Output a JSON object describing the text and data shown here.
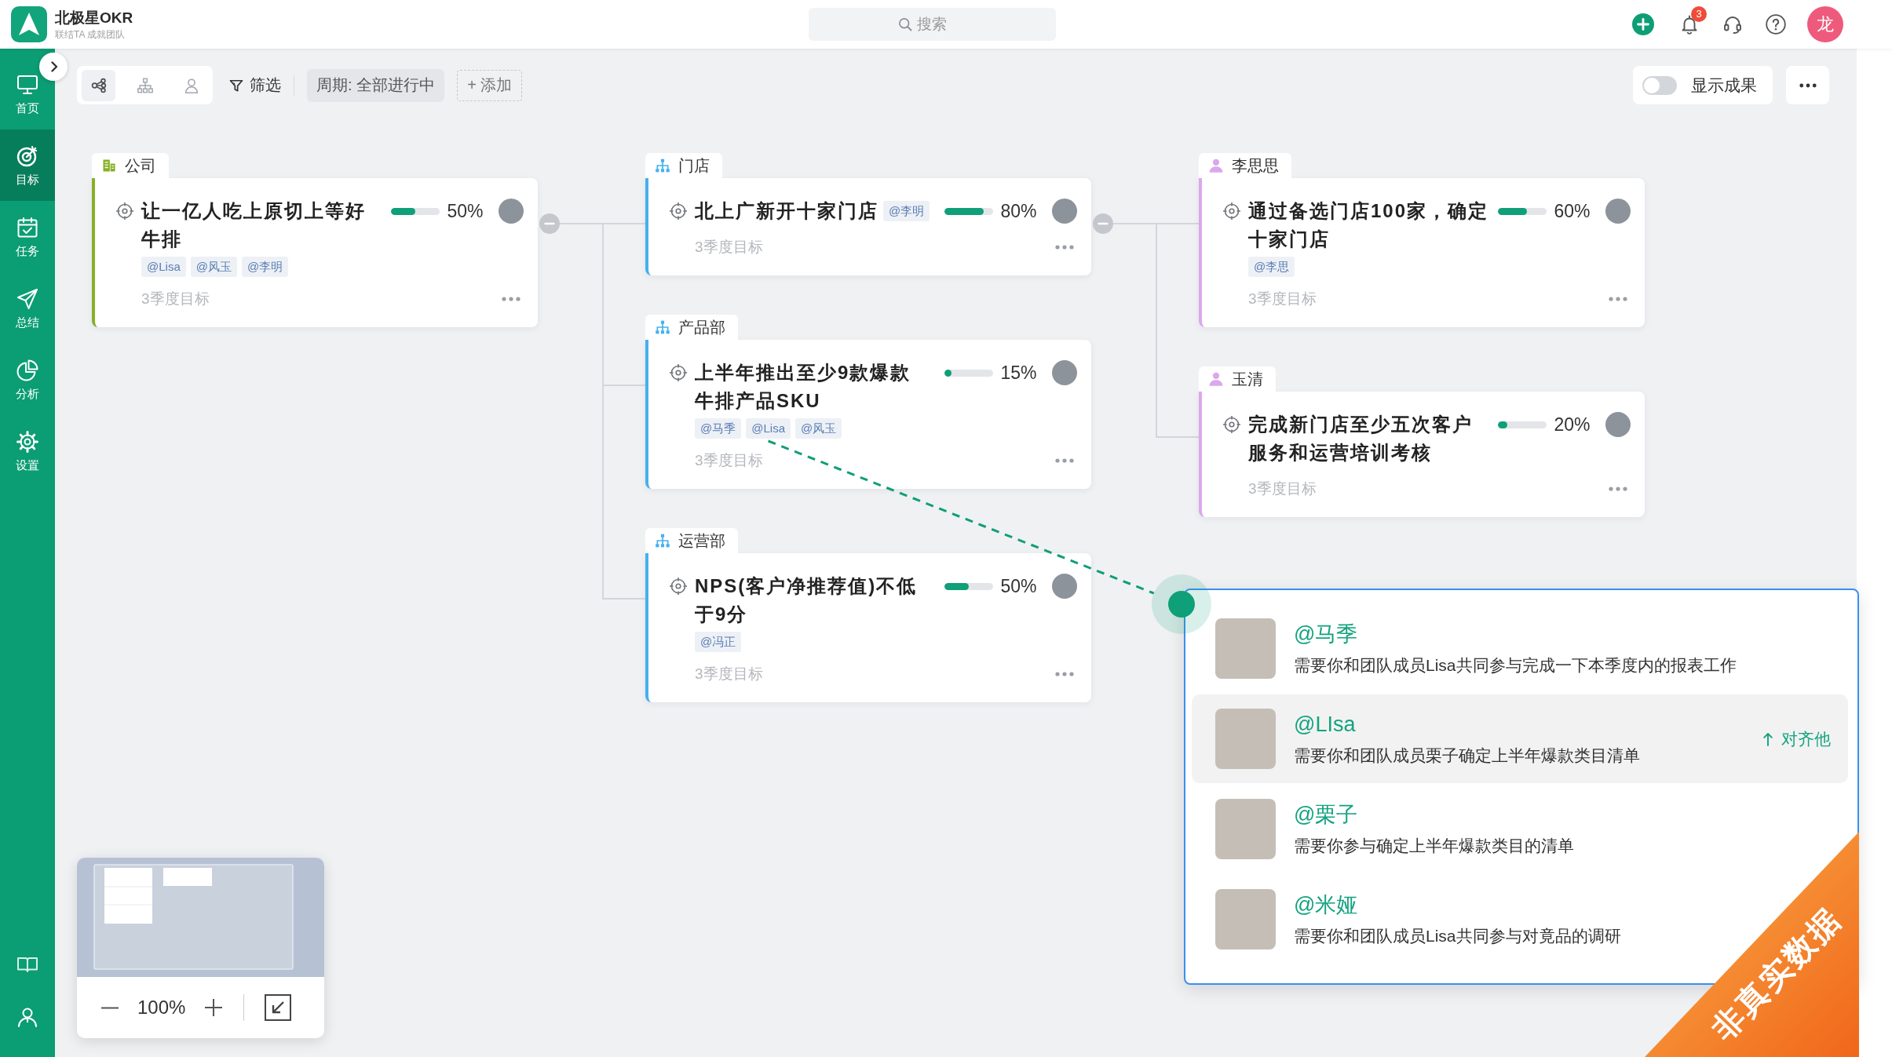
{
  "header": {
    "app_name": "北极星OKR",
    "slogan": "联结TA 成就团队",
    "search": {
      "placeholder": "搜索"
    },
    "notification_count": "3",
    "user_avatar": "龙"
  },
  "sidebar": {
    "items": [
      {
        "kind": "home",
        "label": "首页",
        "selected": false
      },
      {
        "kind": "goals",
        "label": "目标",
        "selected": true
      },
      {
        "kind": "tasks",
        "label": "任务",
        "selected": false
      },
      {
        "kind": "summary",
        "label": "总结",
        "selected": false
      },
      {
        "kind": "analysis",
        "label": "分析",
        "selected": false
      },
      {
        "kind": "settings",
        "label": "设置",
        "selected": false
      }
    ]
  },
  "toolbar": {
    "views": [
      {
        "kind": "mindmap",
        "selected": true
      },
      {
        "kind": "orgchart",
        "selected": false
      },
      {
        "kind": "person",
        "selected": false
      }
    ],
    "filter": "筛选",
    "period": "周期: 全部进行中",
    "add": "+ 添加",
    "show_results": {
      "label": "显示成果",
      "on": false
    }
  },
  "okr_tree": [
    {
      "kind": "company",
      "group": "公司",
      "title": "让一亿人吃上原切上等好牛排",
      "mentions": [
        {
          "text": "@Lisa",
          "linked": false
        },
        {
          "text": "@风玉",
          "linked": false
        },
        {
          "text": "@李明",
          "linked": false
        }
      ],
      "level": 0.5,
      "progress": "50%",
      "period": "3季度目标",
      "children": [
        {
          "kind": "department",
          "group": "门店",
          "title": "北上广新开十家门店",
          "mentions": [
            {
              "text": "@李明",
              "linked": false
            }
          ],
          "level": 0.8,
          "progress": "80%",
          "period": "3季度目标",
          "children": [
            {
              "kind": "person",
              "group": "李思思",
              "title": "通过备选门店100家，确定十家门店",
              "mentions": [
                {
                  "text": "@李思",
                  "linked": false
                }
              ],
              "level": 0.6,
              "progress": "60%",
              "period": "3季度目标"
            },
            {
              "kind": "person",
              "group": "玉清",
              "title": "完成新门店至少五次客户服务和运营培训考核",
              "level": 0.2,
              "progress": "20%",
              "period": "3季度目标"
            }
          ]
        },
        {
          "kind": "department",
          "group": "产品部",
          "title": "上半年推出至少9款爆款牛排产品SKU",
          "mentions": [
            {
              "text": "@马季",
              "linked": false
            },
            {
              "text": "@Lisa",
              "linked": true
            },
            {
              "text": "@风玉",
              "linked": false
            }
          ],
          "level": 0.15,
          "progress": "15%",
          "period": "3季度目标"
        },
        {
          "kind": "department",
          "group": "运营部",
          "title": "NPS(客户净推荐值)不低于9分",
          "mentions": [
            {
              "text": "@冯正",
              "linked": false
            }
          ],
          "level": 0.5,
          "progress": "50%",
          "period": "3季度目标"
        }
      ]
    }
  ],
  "mention_popup": {
    "items": [
      {
        "name": "@马季",
        "message": "需要你和团队成员Lisa共同参与完成一下本季度内的报表工作",
        "selected": false
      },
      {
        "name": "@LIsa",
        "message": "需要你和团队成员栗子确定上半年爆款类目清单",
        "selected": true,
        "action": "对齐他"
      },
      {
        "name": "@栗子",
        "message": "需要你参与确定上半年爆款类目的清单",
        "selected": false
      },
      {
        "name": "@米娅",
        "message": "需要你和团队成员Lisa共同参与对竟品的调研",
        "selected": false
      }
    ]
  },
  "minimap": {
    "zoom": "100%"
  },
  "ribbon": {
    "label": "非真实数据"
  }
}
